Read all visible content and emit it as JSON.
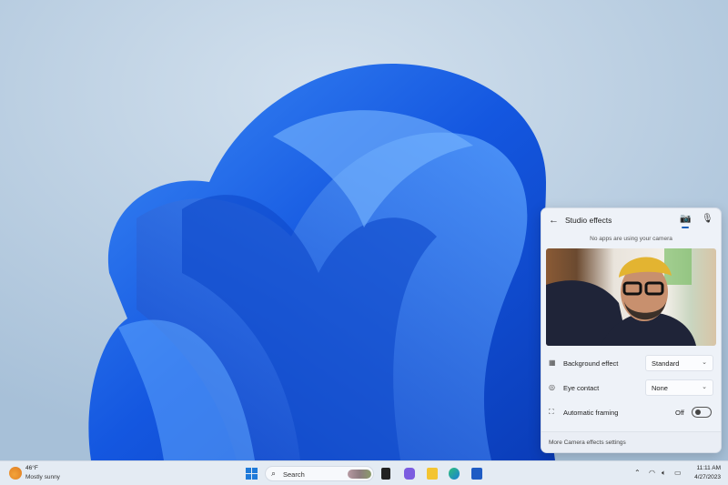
{
  "panel": {
    "title": "Studio effects",
    "status": "No apps are using your camera",
    "settings": [
      {
        "label": "Background effect",
        "value": "Standard",
        "icon": "background-blur-icon"
      },
      {
        "label": "Eye contact",
        "value": "None",
        "icon": "eye-contact-icon"
      },
      {
        "label": "Automatic framing",
        "value": "Off",
        "icon": "framing-icon",
        "toggle_on": false
      }
    ],
    "footer": "More Camera effects settings"
  },
  "taskbar": {
    "weather": {
      "temp": "46°F",
      "desc": "Mostly sunny"
    },
    "search_placeholder": "Search",
    "time": "11:11 AM",
    "date": "4/27/2023"
  },
  "colors": {
    "accent": "#1c5fb8",
    "bloom": "#1a5ee8"
  }
}
